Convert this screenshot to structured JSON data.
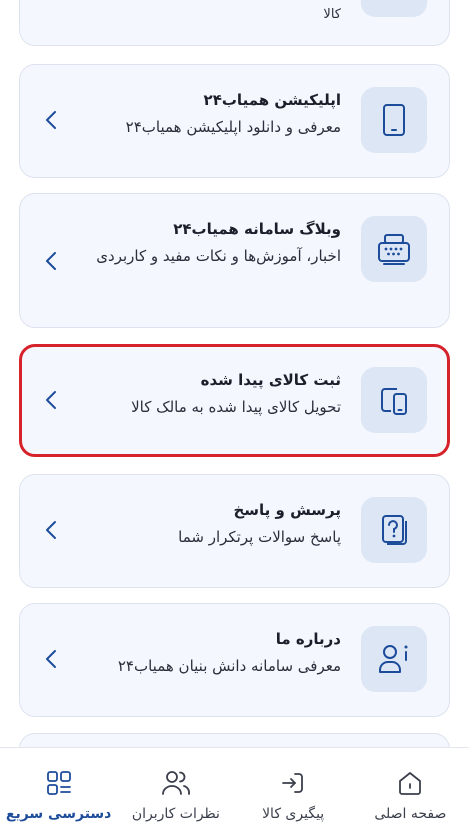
{
  "top_card": {
    "desc_tail": "کالا"
  },
  "cards": [
    {
      "id": "app",
      "title": "اپلیکیشن همیاب۲۴",
      "desc": "معرفی و دانلود اپلیکیشن همیاب۲۴",
      "icon": "mobile-icon"
    },
    {
      "id": "blog",
      "title": "وبلاگ سامانه همیاب۲۴",
      "desc": "اخبار، آموزش‌ها و نکات مفید و کاربردی",
      "icon": "blog-icon"
    },
    {
      "id": "found",
      "title": "ثبت کالای پیدا شده",
      "desc": "تحویل کالای پیدا شده به مالک کالا",
      "icon": "devices-icon",
      "highlighted": true
    },
    {
      "id": "faq",
      "title": "پرسش و پاسخ",
      "desc": "پاسخ سوالات پرتکرار شما",
      "icon": "question-icon"
    },
    {
      "id": "about",
      "title": "درباره ما",
      "desc": "معرفی سامانه دانش بنیان همیاب۲۴",
      "icon": "user-info-icon"
    }
  ],
  "bottom_nav": [
    {
      "label": "صفحه اصلی",
      "icon": "home-icon"
    },
    {
      "label": "پیگیری کالا",
      "icon": "login-arrow-icon"
    },
    {
      "label": "نظرات کاربران",
      "icon": "users-icon"
    },
    {
      "label": "دسترسی سریع",
      "icon": "grid-icon",
      "active": true
    }
  ],
  "colors": {
    "accent": "#1d4c9b",
    "highlight_border": "#d6222b",
    "card_bg": "#f4f7fd",
    "icon_bg": "#dde6f5"
  }
}
